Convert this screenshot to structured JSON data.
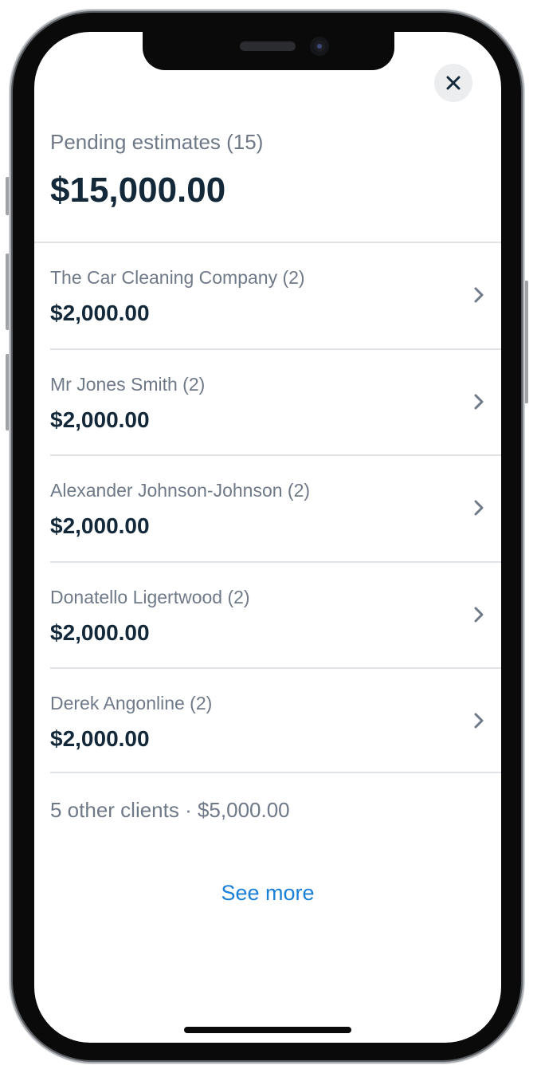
{
  "header": {
    "close_icon": "close-icon"
  },
  "summary": {
    "title": "Pending estimates (15)",
    "total": "$15,000.00"
  },
  "clients": [
    {
      "name": "The Car Cleaning Company (2)",
      "amount": "$2,000.00"
    },
    {
      "name": "Mr Jones Smith (2)",
      "amount": "$2,000.00"
    },
    {
      "name": "Alexander Johnson-Johnson (2)",
      "amount": "$2,000.00"
    },
    {
      "name": "Donatello Ligertwood (2)",
      "amount": "$2,000.00"
    },
    {
      "name": "Derek Angonline (2)",
      "amount": "$2,000.00"
    }
  ],
  "footer": {
    "other_clients": "5 other clients · $5,000.00",
    "see_more_label": "See more"
  },
  "colors": {
    "text_primary": "#13293a",
    "text_secondary": "#6f7987",
    "link": "#1a7fd7",
    "divider": "#dfe2e6",
    "close_button_bg": "#ebedef"
  }
}
